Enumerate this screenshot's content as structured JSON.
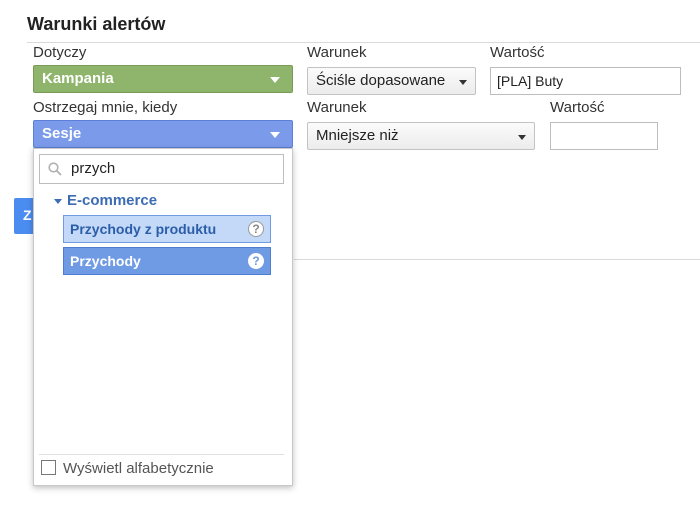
{
  "title": "Warunki alertów",
  "row1": {
    "applies_label": "Dotyczy",
    "applies_value": "Kampania",
    "condition_label": "Warunek",
    "condition_value": "Ściśle dopasowane",
    "value_label": "Wartość",
    "value_input": "[PLA] Buty"
  },
  "row2": {
    "alert_label": "Ostrzegaj mnie, kiedy",
    "alert_value": "Sesje",
    "condition_label": "Warunek",
    "condition_value": "Mniejsze niż",
    "value_label": "Wartość",
    "value_input": ""
  },
  "side_button_label": "Z",
  "dropdown": {
    "search_value": "przych",
    "category": "E-commerce",
    "items": [
      {
        "label": "Przychody z produktu",
        "help": "?"
      },
      {
        "label": "Przychody",
        "help": "?"
      }
    ],
    "alphabetical_label": "Wyświetl alfabetycznie",
    "alphabetical_checked": false
  },
  "colors": {
    "campaign_green": "#8fb46b",
    "metric_blue": "#7b9bea",
    "category_blue": "#3c6cb4",
    "selected_item": "#6f9ae4"
  }
}
